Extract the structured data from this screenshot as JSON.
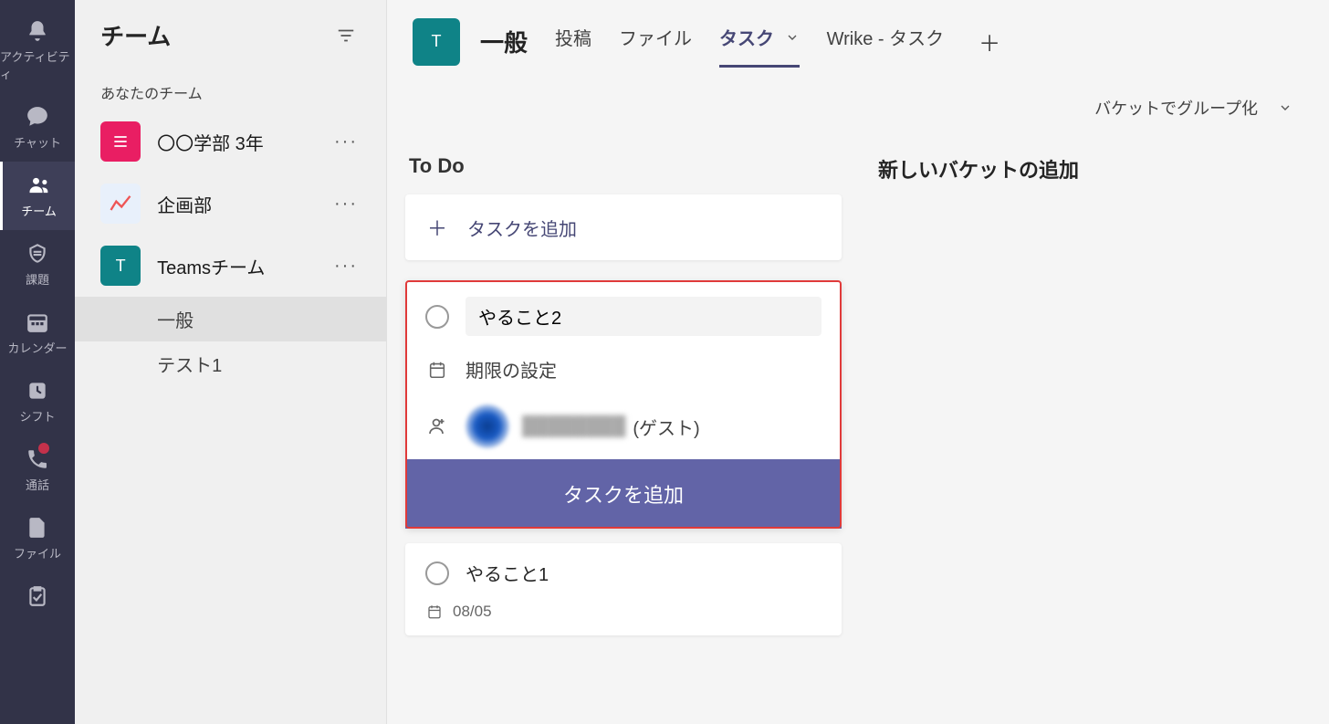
{
  "rail": {
    "items": [
      {
        "label": "アクティビティ",
        "icon": "bell"
      },
      {
        "label": "チャット",
        "icon": "chat"
      },
      {
        "label": "チーム",
        "icon": "teams",
        "active": true
      },
      {
        "label": "課題",
        "icon": "assignments"
      },
      {
        "label": "カレンダー",
        "icon": "calendar"
      },
      {
        "label": "シフト",
        "icon": "shifts"
      },
      {
        "label": "通話",
        "icon": "call",
        "badge": true
      },
      {
        "label": "ファイル",
        "icon": "file"
      },
      {
        "label": "",
        "icon": "more"
      }
    ]
  },
  "panel": {
    "title": "チーム",
    "section_label": "あなたのチーム",
    "teams": [
      {
        "name": "〇〇学部 3年",
        "avatar_letter": "☰",
        "avatar_bg": "#e91e63"
      },
      {
        "name": "企画部",
        "avatar_chart": true,
        "avatar_bg": "#dbeafe"
      },
      {
        "name": "Teamsチーム",
        "avatar_letter": "T",
        "avatar_bg": "#0f8387",
        "channels": [
          {
            "name": "一般",
            "active": true
          },
          {
            "name": "テスト1"
          }
        ]
      }
    ]
  },
  "main": {
    "avatar_letter": "T",
    "title": "一般",
    "tabs": [
      {
        "label": "投稿"
      },
      {
        "label": "ファイル"
      },
      {
        "label": "タスク",
        "active": true,
        "has_chevron": true
      },
      {
        "label": "Wrike - タスク"
      }
    ],
    "groupby": {
      "label": "バケットでグループ化"
    },
    "buckets": [
      {
        "title": "To Do",
        "add_label": "タスクを追加",
        "expanded_task": {
          "input_value": "やること2",
          "due_label": "期限の設定",
          "assignee_name": "████████",
          "guest_suffix": "(ゲスト)",
          "add_button": "タスクを追加"
        },
        "tasks": [
          {
            "title": "やること1",
            "date": "08/05"
          }
        ]
      },
      {
        "new_bucket_label": "新しいバケットの追加"
      }
    ]
  }
}
